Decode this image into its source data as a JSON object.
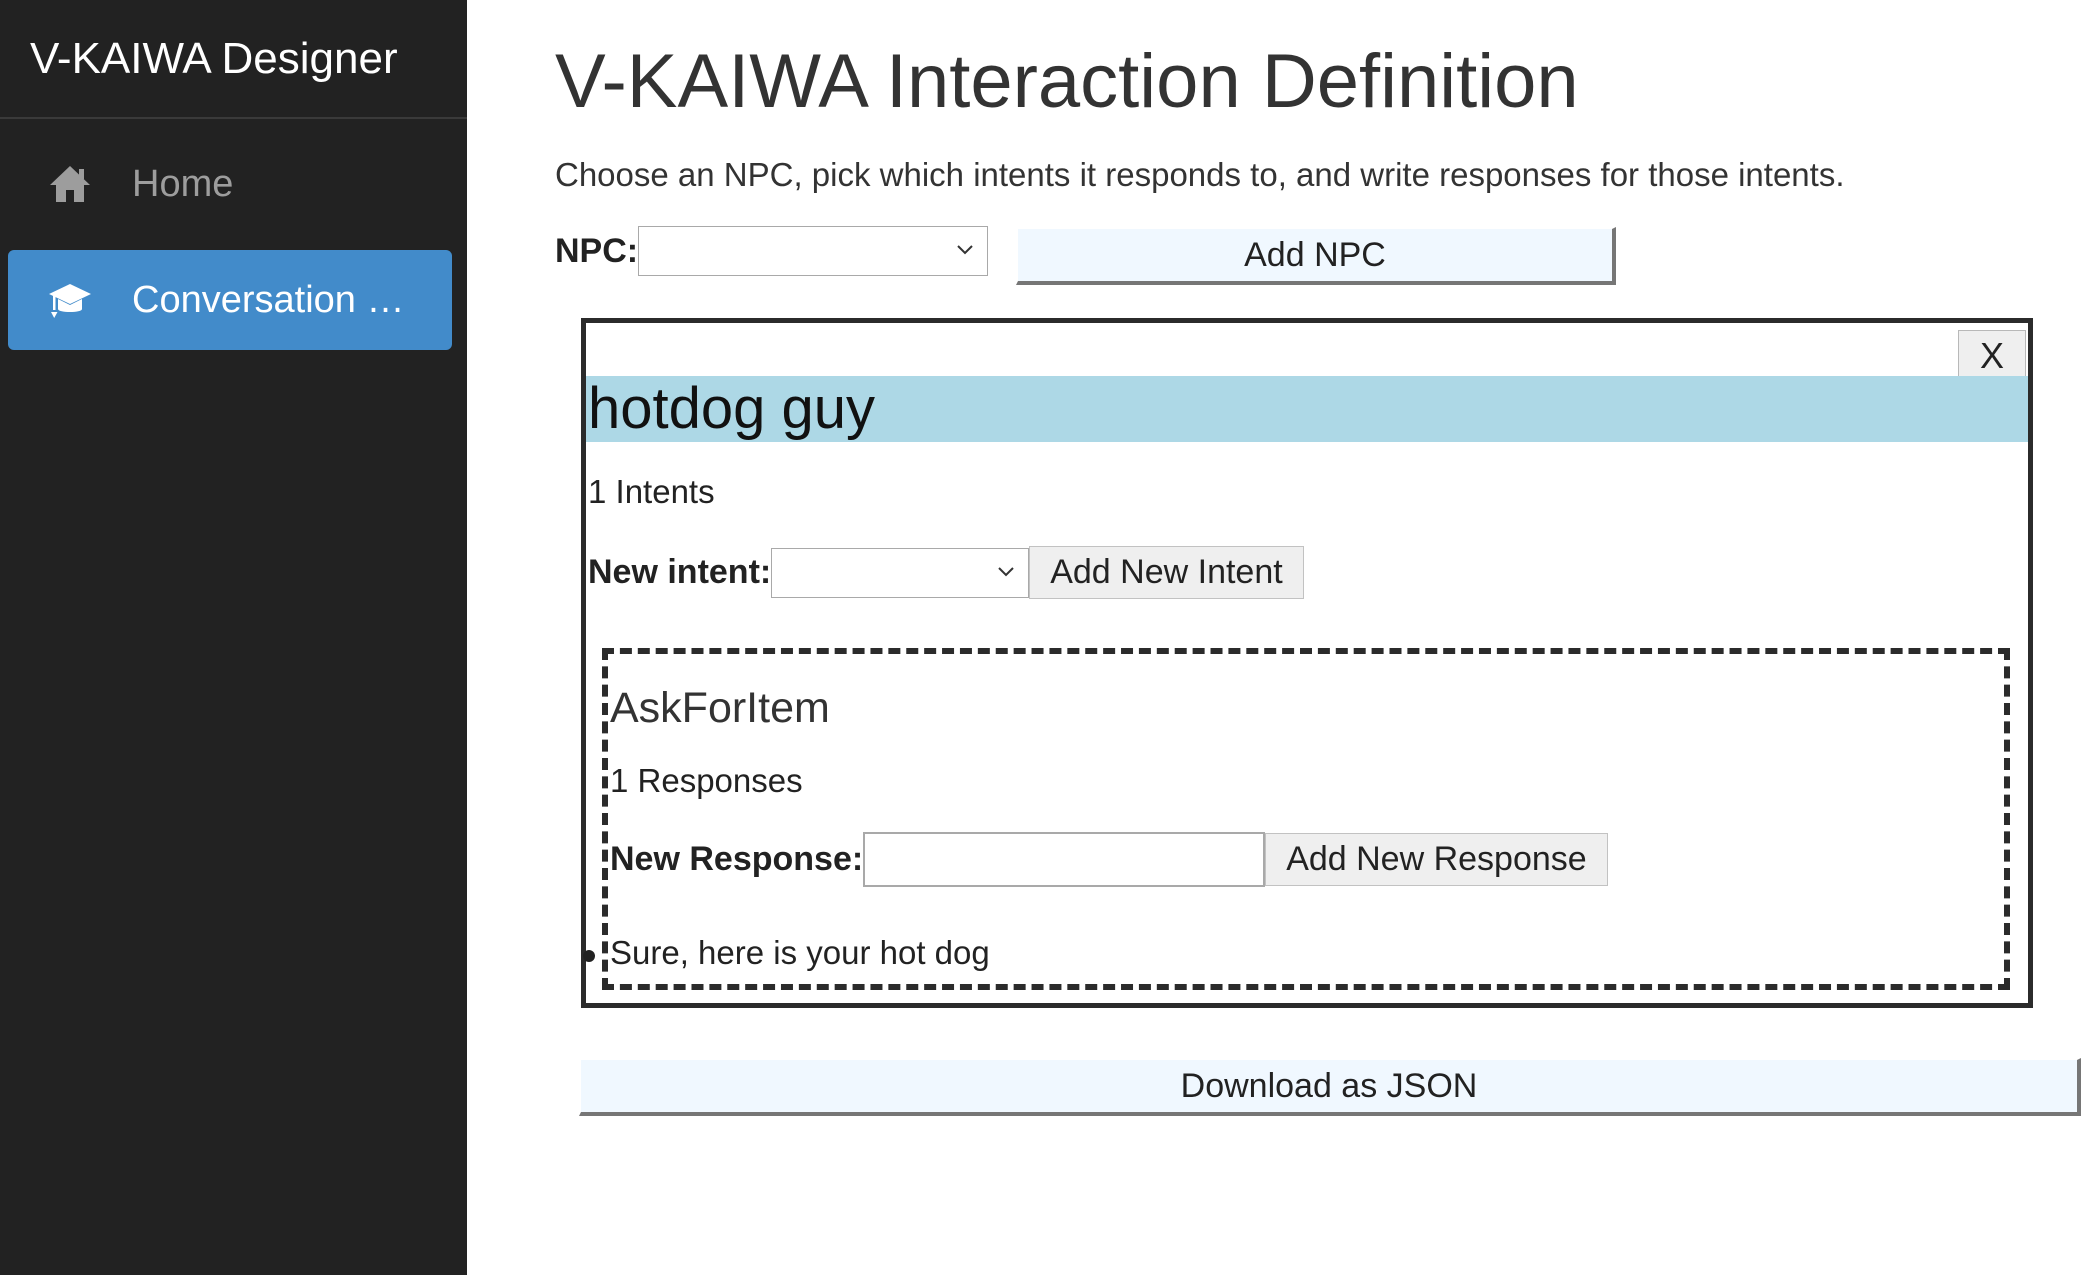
{
  "sidebar": {
    "brand": "V-KAIWA Designer",
    "items": [
      {
        "label": "Home",
        "icon": "home-icon",
        "active": false
      },
      {
        "label": "Conversation …",
        "icon": "graduation-cap-icon",
        "active": true
      }
    ],
    "background": "#222222",
    "active_color": "#428bca"
  },
  "header": {
    "title": "V-KAIWA Interaction Definition",
    "subtitle": "Choose an NPC, pick which intents it responds to, and write responses for those intents."
  },
  "npc_selector": {
    "label": "NPC:",
    "selected": "",
    "add_button": "Add NPC"
  },
  "npc": {
    "close_label": "X",
    "name": "hotdog guy",
    "name_bg": "#add8e6",
    "intent_count": "1 Intents",
    "new_intent_label": "New intent:",
    "new_intent_selected": "",
    "add_intent_button": "Add New Intent",
    "intents": [
      {
        "name": "AskForItem",
        "response_count": "1 Responses",
        "new_response_label": "New Response:",
        "new_response_value": "",
        "add_response_button": "Add New Response",
        "responses": [
          "Sure, here is your hot dog"
        ]
      }
    ]
  },
  "download_button": "Download as JSON"
}
